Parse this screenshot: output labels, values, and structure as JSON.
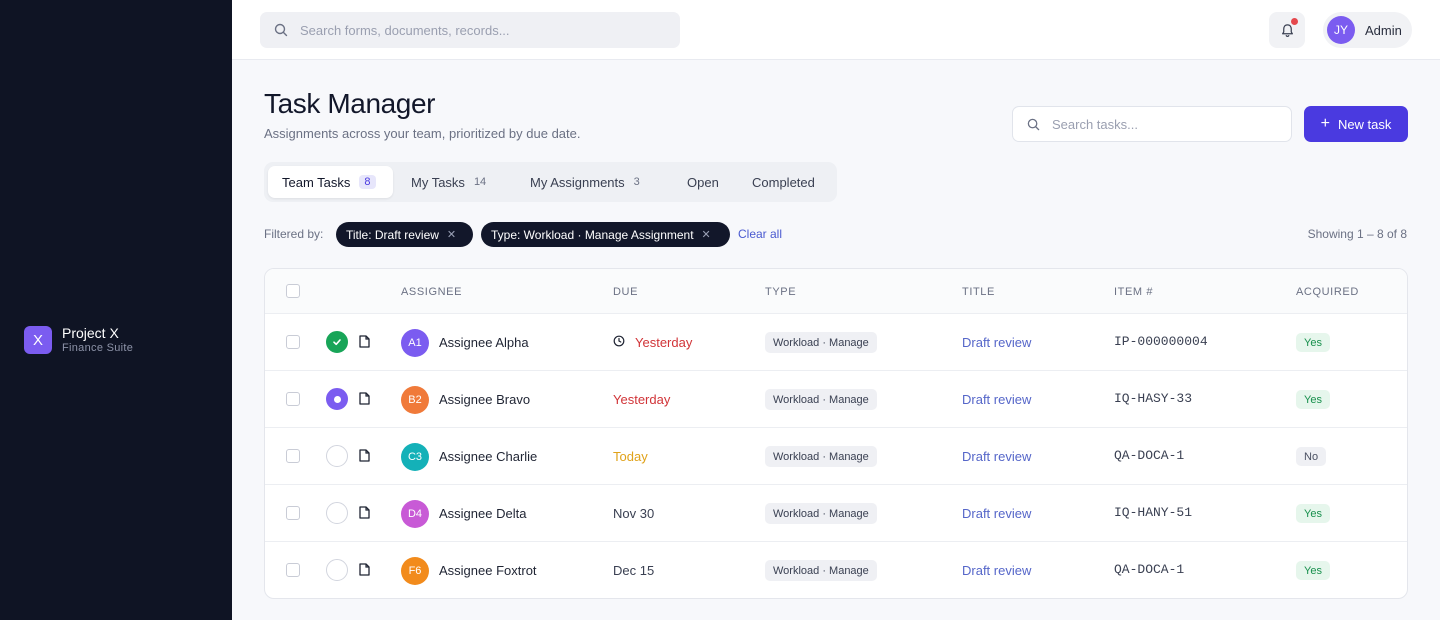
{
  "brand": {
    "logo": "X",
    "name": "Project X",
    "subtitle": "Finance Suite"
  },
  "topbar": {
    "search_placeholder": "Search forms, documents, records...",
    "notifications_icon": "bell-icon",
    "user": {
      "initials": "JY",
      "name": "Admin"
    }
  },
  "page": {
    "title": "Task Manager",
    "subtitle": "Assignments across your team, prioritized by due date.",
    "search_placeholder": "Search tasks...",
    "new_task_label": "New task"
  },
  "tabs": [
    {
      "label": "Team Tasks",
      "count": "8",
      "active": true
    },
    {
      "label": "My Tasks",
      "count": "14"
    },
    {
      "label": "My Assignments",
      "count": "3"
    },
    {
      "label": "Open",
      "count": ""
    },
    {
      "label": "Completed",
      "count": ""
    }
  ],
  "filters": {
    "label": "Filtered by:",
    "chips": [
      "Title: Draft review",
      "Type: Workload · Manage Assignment"
    ],
    "clear_label": "Clear all",
    "showing": "Showing 1 – 8 of 8"
  },
  "table": {
    "columns": [
      "ASSIGNEE",
      "DUE",
      "TYPE",
      "TITLE",
      "ITEM #",
      "ACQUIRED"
    ],
    "rows": [
      {
        "status": "done",
        "initials": "A1",
        "avatar_color": "#7b5cf0",
        "assignee": "Assignee Alpha",
        "due": "Yesterday",
        "due_color": "#d13438",
        "overdue_icon": true,
        "type": "Workload · Manage",
        "title": "Draft review",
        "item": "IP-000000004",
        "acquired": "Yes"
      },
      {
        "status": "progress",
        "initials": "B2",
        "avatar_color": "#f07a3a",
        "assignee": "Assignee Bravo",
        "due": "Yesterday",
        "due_color": "#d13438",
        "overdue_icon": false,
        "type": "Workload · Manage",
        "title": "Draft review",
        "item": "IQ-HASY-33",
        "acquired": "Yes"
      },
      {
        "status": "open",
        "initials": "C3",
        "avatar_color": "#14b1b8",
        "assignee": "Assignee Charlie",
        "due": "Today",
        "due_color": "#e0a21a",
        "overdue_icon": false,
        "type": "Workload · Manage",
        "title": "Draft review",
        "item": "QA-DOCA-1",
        "acquired": "No"
      },
      {
        "status": "open",
        "initials": "D4",
        "avatar_color": "#c85ad6",
        "assignee": "Assignee Delta",
        "due": "Nov 30",
        "due_color": "#3a4052",
        "overdue_icon": false,
        "type": "Workload · Manage",
        "title": "Draft review",
        "item": "IQ-HANY-51",
        "acquired": "Yes"
      },
      {
        "status": "open",
        "initials": "F6",
        "avatar_color": "#f28b1c",
        "assignee": "Assignee Foxtrot",
        "due": "Dec 15",
        "due_color": "#3a4052",
        "overdue_icon": false,
        "type": "Workload · Manage",
        "title": "Draft review",
        "item": "QA-DOCA-1",
        "acquired": "Yes"
      }
    ]
  }
}
